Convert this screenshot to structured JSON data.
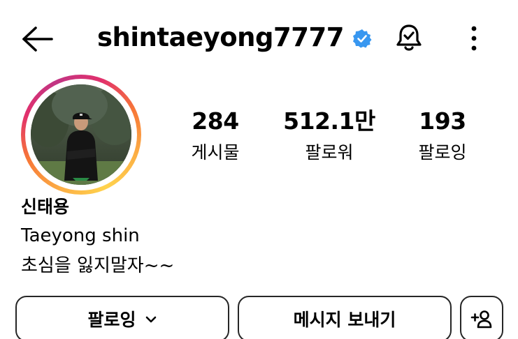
{
  "header": {
    "username": "shintaeyong7777",
    "icons": [
      "back-arrow-icon",
      "verified-badge-icon",
      "notification-bell-icon",
      "more-options-icon"
    ],
    "verified_color": "#3897f0"
  },
  "profile": {
    "stats": [
      {
        "value": "284",
        "label": "게시물"
      },
      {
        "value": "512.1만",
        "label": "팔로워"
      },
      {
        "value": "193",
        "label": "팔로잉"
      }
    ],
    "full_name": "신태용",
    "bio": [
      "Taeyong shin",
      "초심을 잃지말자~~"
    ],
    "story_ring_colors": [
      "#fcaf45",
      "#f77737",
      "#e1306c",
      "#c13584"
    ]
  },
  "actions": {
    "follow_label": "팔로잉",
    "message_label": "메시지 보내기"
  }
}
